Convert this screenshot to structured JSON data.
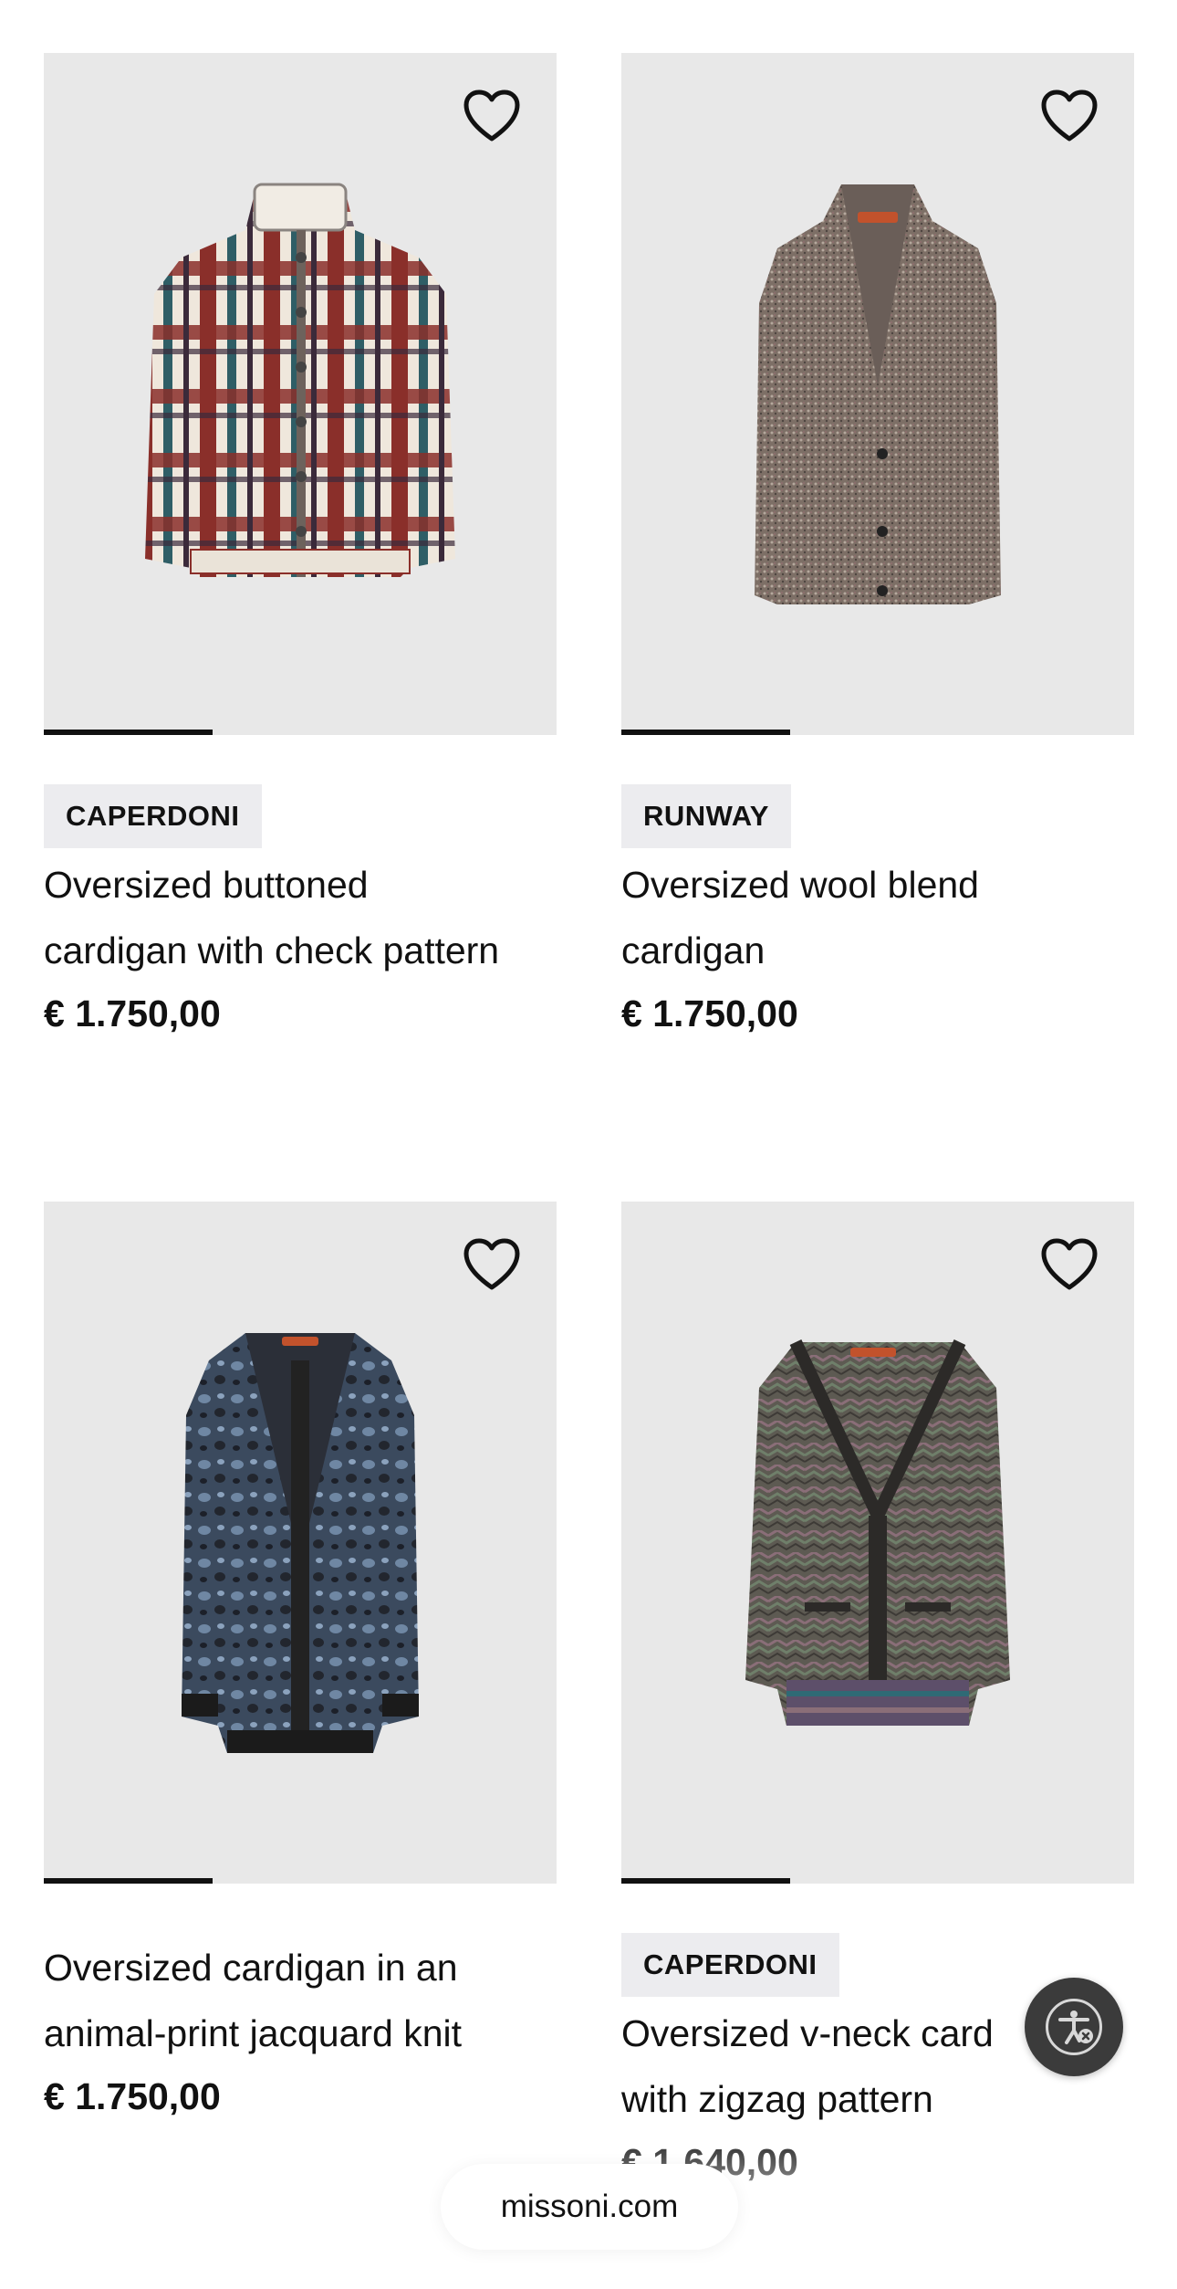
{
  "products": [
    {
      "badge": "CAPERDONI",
      "title_line1": "Oversized buttoned",
      "title_line2": "cardigan with check pattern",
      "price": "€ 1.750,00",
      "image_progress": 0.33
    },
    {
      "badge": "RUNWAY",
      "title_line1": "Oversized wool blend",
      "title_line2": "cardigan",
      "price": "€ 1.750,00",
      "image_progress": 0.33
    },
    {
      "badge": "",
      "title_line1": "Oversized cardigan in an",
      "title_line2": "animal-print jacquard knit",
      "price": "€ 1.750,00",
      "image_progress": 0.33
    },
    {
      "badge": "CAPERDONI",
      "title_line1": "Oversized v-neck card",
      "title_line2": "with zigzag pattern",
      "price": "€ 1.640,00",
      "image_progress": 0.33
    }
  ],
  "icons": {
    "wishlist": "heart-outline-icon",
    "accessibility": "accessibility-icon"
  },
  "browser": {
    "url": "missoni.com"
  },
  "colors": {
    "image_bg": "#e8e8e8",
    "badge_bg": "#ececef",
    "text": "#111111",
    "a11y_bg": "#3b3b3b"
  }
}
